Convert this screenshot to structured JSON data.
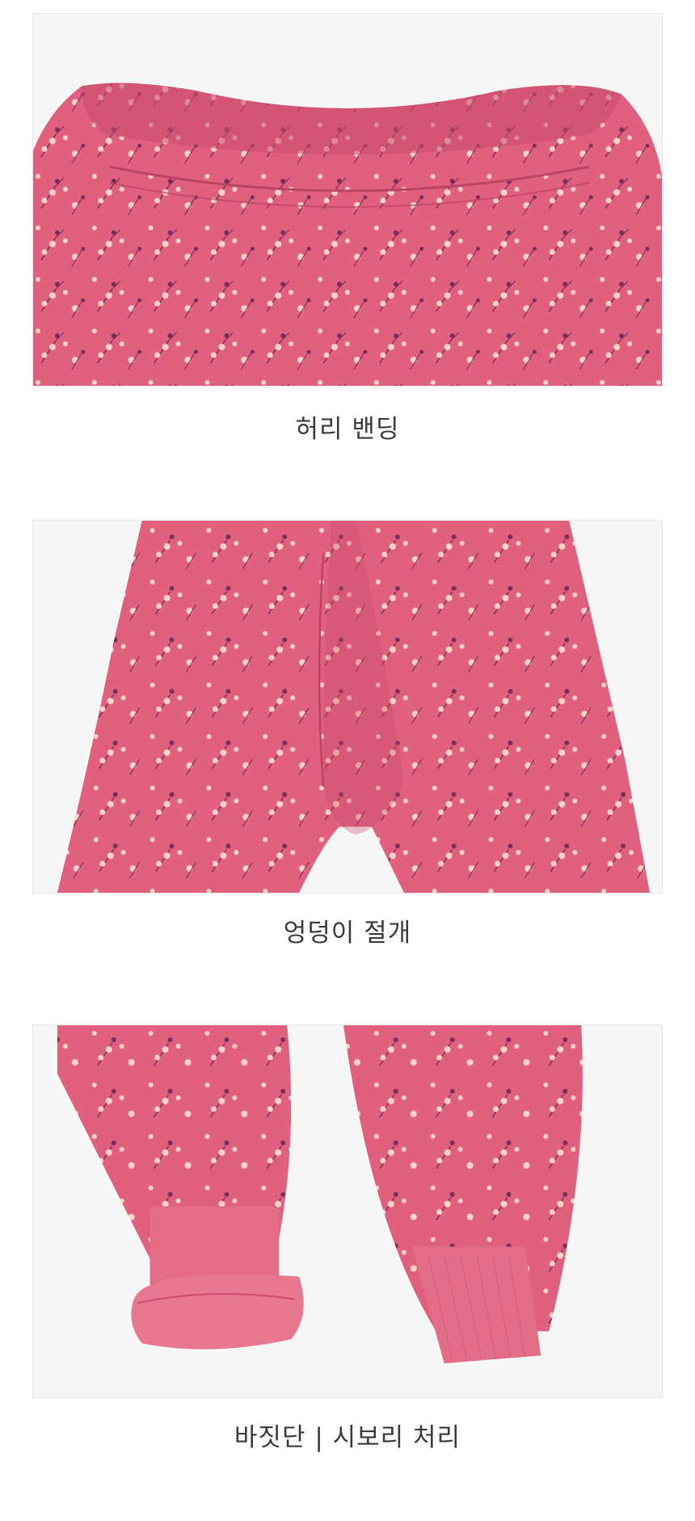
{
  "colors": {
    "fabric": "#e1607e",
    "fabric_dark": "#c94c6a",
    "flower": "#fbd3c4",
    "stem": "#7b2d57",
    "cuff": "#e36d86",
    "background": "#f7f7f7",
    "caption_text": "#3a3a3a"
  },
  "sections": [
    {
      "caption": "허리 밴딩",
      "image_icon": "waistband-photo"
    },
    {
      "caption": "엉덩이 절개",
      "image_icon": "hip-seam-photo"
    },
    {
      "caption": "바짓단 | 시보리 처리",
      "image_icon": "rib-cuff-photo"
    }
  ]
}
